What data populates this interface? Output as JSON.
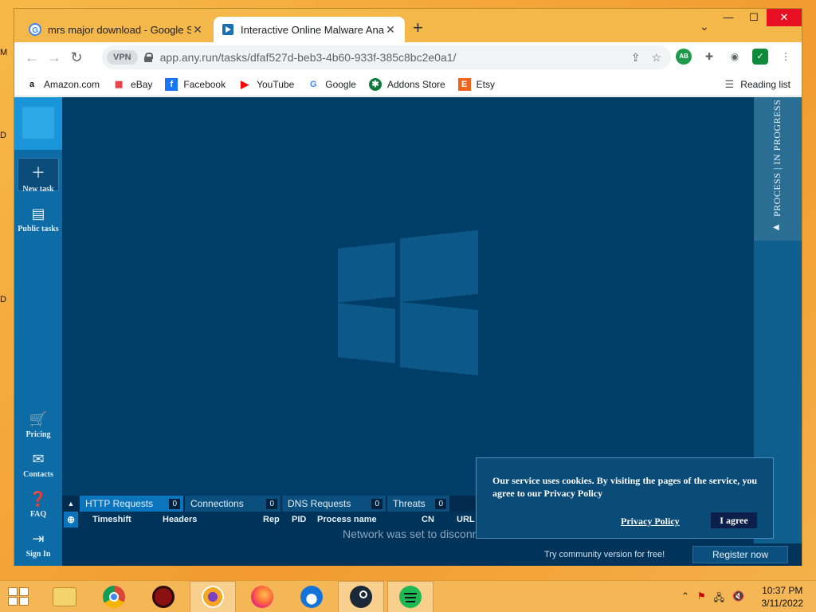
{
  "desktop": {
    "frags": [
      "M",
      "D",
      "D"
    ]
  },
  "browser": {
    "tabs": [
      {
        "title": "mrs major download - Google Se",
        "icon": "google-icon"
      },
      {
        "title": "Interactive Online Malware Analy",
        "icon": "anyrun-icon"
      }
    ],
    "new_tab": "+",
    "window_controls": {
      "minimize": "—",
      "maximize": "☐",
      "close": "✕"
    },
    "vpn_label": "VPN",
    "url": "app.any.run/tasks/dfaf527d-beb3-4b60-933f-385c8bc2e0a1/",
    "bookmarks": [
      {
        "label": "Amazon.com",
        "icon": "amazon-icon"
      },
      {
        "label": "eBay",
        "icon": "ebay-icon"
      },
      {
        "label": "Facebook",
        "icon": "facebook-icon"
      },
      {
        "label": "YouTube",
        "icon": "youtube-icon"
      },
      {
        "label": "Google",
        "icon": "google-icon"
      },
      {
        "label": "Addons Store",
        "icon": "addons-store-icon"
      },
      {
        "label": "Etsy",
        "icon": "etsy-icon"
      }
    ],
    "reading_list": "Reading list"
  },
  "sidebar": {
    "items": [
      {
        "label": "New task",
        "icon": "plus-icon"
      },
      {
        "label": "Public tasks",
        "icon": "document-icon"
      },
      {
        "label": "Pricing",
        "icon": "cart-icon"
      },
      {
        "label": "Contacts",
        "icon": "mail-icon"
      },
      {
        "label": "FAQ",
        "icon": "help-icon"
      },
      {
        "label": "Sign In",
        "icon": "sign-in-icon"
      }
    ]
  },
  "right_panel": {
    "label": "PROCESS | IN PROGRESS"
  },
  "network": {
    "tabs": [
      {
        "label": "HTTP Requests",
        "count": "0"
      },
      {
        "label": "Connections",
        "count": "0"
      },
      {
        "label": "DNS Requests",
        "count": "0"
      },
      {
        "label": "Threats",
        "count": "0"
      }
    ],
    "columns": [
      "Timeshift",
      "Headers",
      "Rep",
      "PID",
      "Process name",
      "CN",
      "URL"
    ],
    "message": "Network was set to disconnected"
  },
  "bottom": {
    "try_text": "Try community version for free!",
    "register": "Register now"
  },
  "cookie": {
    "text": "Our service uses cookies. By visiting the pages of the service, you agree to our Privacy Policy",
    "privacy_link": "Privacy Policy",
    "agree": "I agree"
  },
  "taskbar": {
    "apps": [
      "file-explorer-icon",
      "chrome-icon",
      "app-red-icon",
      "tor-browser-icon",
      "firefox-icon",
      "thunderbird-icon",
      "steam-icon",
      "spotify-icon"
    ],
    "time": "10:37 PM",
    "date": "3/11/2022"
  }
}
